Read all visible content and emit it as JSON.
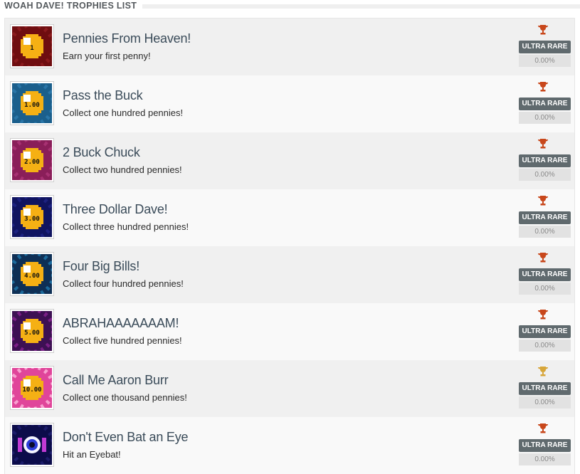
{
  "header": {
    "title": "WOAH DAVE! TROPHIES LIST"
  },
  "trophies": [
    {
      "name": "Pennies From Heaven!",
      "desc": "Earn your first penny!",
      "rarity": "ULTRA RARE",
      "percent": "0.00%",
      "badge_label": "1",
      "badge_bg": "#6f0d10",
      "badge_ray": "#8a1a1d",
      "trophy_color": "#c8471b"
    },
    {
      "name": "Pass the Buck",
      "desc": "Collect one hundred pennies!",
      "rarity": "ULTRA RARE",
      "percent": "0.00%",
      "badge_label": "1.00",
      "badge_bg": "#1b5f8c",
      "badge_ray": "#2a76a8",
      "trophy_color": "#c8471b"
    },
    {
      "name": "2 Buck Chuck",
      "desc": "Collect two hundred pennies!",
      "rarity": "ULTRA RARE",
      "percent": "0.00%",
      "badge_label": "2.00",
      "badge_bg": "#8a1e59",
      "badge_ray": "#a73172",
      "trophy_color": "#c8471b"
    },
    {
      "name": "Three Dollar Dave!",
      "desc": "Collect three hundred pennies!",
      "rarity": "ULTRA RARE",
      "percent": "0.00%",
      "badge_label": "3.00",
      "badge_bg": "#101460",
      "badge_ray": "#1d2280",
      "trophy_color": "#c8471b"
    },
    {
      "name": "Four Big Bills!",
      "desc": "Collect four hundred pennies!",
      "rarity": "ULTRA RARE",
      "percent": "0.00%",
      "badge_label": "4.00",
      "badge_bg": "#0e2f55",
      "badge_ray": "#1b6a9c",
      "trophy_color": "#c8471b"
    },
    {
      "name": "ABRAHAAAAAAAM!",
      "desc": "Collect five hundred pennies!",
      "rarity": "ULTRA RARE",
      "percent": "0.00%",
      "badge_label": "5.00",
      "badge_bg": "#3d1053",
      "badge_ray": "#7a1f86",
      "trophy_color": "#c8471b"
    },
    {
      "name": "Call Me Aaron Burr",
      "desc": "Collect one thousand pennies!",
      "rarity": "ULTRA RARE",
      "percent": "0.00%",
      "badge_label": "10.00",
      "badge_bg": "#e0459a",
      "badge_ray": "#f8a0cf",
      "trophy_color": "#d7a63a"
    },
    {
      "name": "Don't Even Bat an Eye",
      "desc": "Hit an Eyebat!",
      "rarity": "ULTRA RARE",
      "percent": "0.00%",
      "badge_label": "",
      "badge_bg": "#0c0c4a",
      "badge_ray": "#1c1c6a",
      "trophy_color": "#c8471b"
    }
  ]
}
